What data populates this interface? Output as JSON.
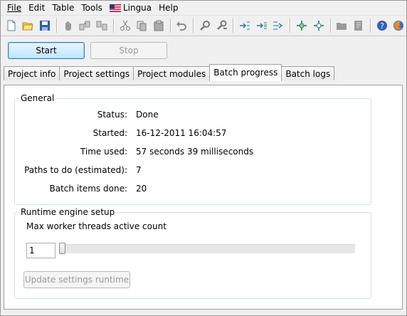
{
  "menu": [
    "File",
    "Edit",
    "Table",
    "Tools",
    "Lingua",
    "Help"
  ],
  "toolbar_icons": [
    "new-file-icon",
    "open-folder-icon",
    "save-icon",
    "hand-icon",
    "copy-rows-icon",
    "paste-rows-icon",
    "cut-icon",
    "copy-icon",
    "paste-icon",
    "undo-icon",
    "find-icon",
    "find-replace-icon",
    "insert-row-icon",
    "insert-col-icon",
    "append-icon",
    "split-icon",
    "merge-icon",
    "folder-icon",
    "notes-icon",
    "help-icon",
    "firefox-icon"
  ],
  "controls": {
    "start": "Start",
    "stop": "Stop"
  },
  "tabs": [
    "Project info",
    "Project settings",
    "Project modules",
    "Batch progress",
    "Batch logs"
  ],
  "active_tab": "Batch progress",
  "general": {
    "title": "General",
    "rows": [
      {
        "label": "Status:",
        "value": "Done"
      },
      {
        "label": "Started:",
        "value": "16-12-2011 16:04:57"
      },
      {
        "label": "Time used:",
        "value": "57 seconds 39 milliseconds"
      },
      {
        "label": "Paths to do (estimated):",
        "value": "7"
      },
      {
        "label": "Batch items done:",
        "value": "20"
      }
    ]
  },
  "runtime": {
    "title": "Runtime engine setup",
    "threads_label": "Max worker threads active count",
    "threads_value": "1",
    "slider_level": 0,
    "update_button": "Update settings runtime"
  }
}
